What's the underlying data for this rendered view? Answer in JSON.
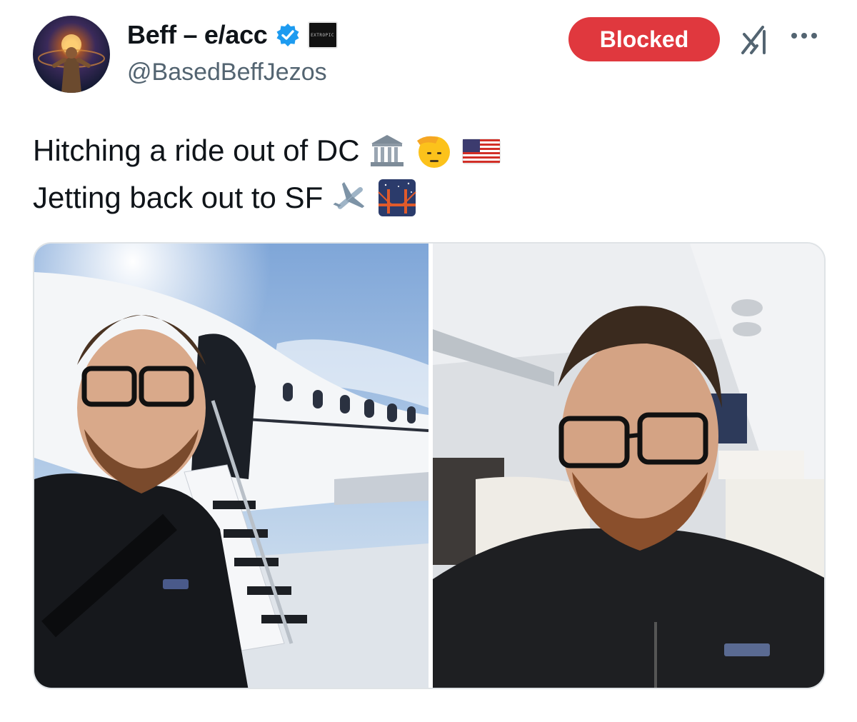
{
  "author": {
    "display_name": "Beff – e/acc",
    "handle": "@BasedBeffJezos",
    "verified": true,
    "affiliation_label": "EXTROPIC"
  },
  "actions": {
    "blocked_label": "Blocked",
    "grok_icon": "grok-icon",
    "more_icon": "more-icon"
  },
  "tweet": {
    "line1": "Hitching a ride out of DC",
    "line1_emojis": [
      "classical-building-icon",
      "saluting-face-icon",
      "us-flag-icon"
    ],
    "line2": "Jetting back out to SF",
    "line2_emojis": [
      "airplane-icon",
      "bridge-at-night-icon"
    ]
  },
  "media": {
    "left_fleece_logo": "patagonia",
    "right_fleece_logo": "patagonia"
  },
  "colors": {
    "blocked_bg": "#e0383e",
    "verified_blue": "#1d9bf0",
    "handle_gray": "#536471"
  }
}
